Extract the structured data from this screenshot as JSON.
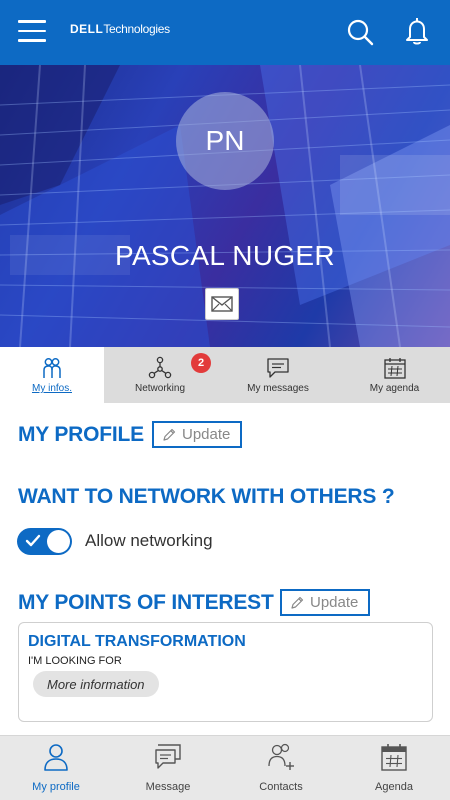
{
  "header": {
    "logo_brand": "DELL",
    "logo_suffix": "Technologies",
    "icons": [
      "menu-icon",
      "search-icon",
      "bell-icon"
    ]
  },
  "profile": {
    "initials": "PN",
    "name": "PASCAL NUGER",
    "mail_icon": "envelope-icon"
  },
  "tabs": [
    {
      "label": "My infos.",
      "icon": "people-icon",
      "active": true
    },
    {
      "label": "Networking",
      "icon": "network-icon",
      "badge": "2"
    },
    {
      "label": "My messages",
      "icon": "chat-icon"
    },
    {
      "label": "My agenda",
      "icon": "calendar-icon"
    }
  ],
  "my_profile": {
    "title": "MY PROFILE",
    "update_label": "Update"
  },
  "network": {
    "title": "WANT TO NETWORK WITH OTHERS ?",
    "toggle_label": "Allow networking",
    "toggle_on": true
  },
  "points_of_interest": {
    "title": "MY POINTS OF INTEREST",
    "update_label": "Update",
    "items": [
      {
        "title": "DIGITAL TRANSFORMATION",
        "subtitle": "I'M LOOKING FOR",
        "button": "More information"
      }
    ]
  },
  "bottom_nav": [
    {
      "label": "My profile",
      "icon": "person-icon",
      "active": true
    },
    {
      "label": "Message",
      "icon": "chat-icon"
    },
    {
      "label": "Contacts",
      "icon": "contacts-icon"
    },
    {
      "label": "Agenda",
      "icon": "calendar-icon"
    }
  ],
  "colors": {
    "primary": "#0d6ac4",
    "badge": "#e23b3b",
    "tab_bar": "#dcdcdc",
    "bottom_nav": "#e8e8e8"
  }
}
